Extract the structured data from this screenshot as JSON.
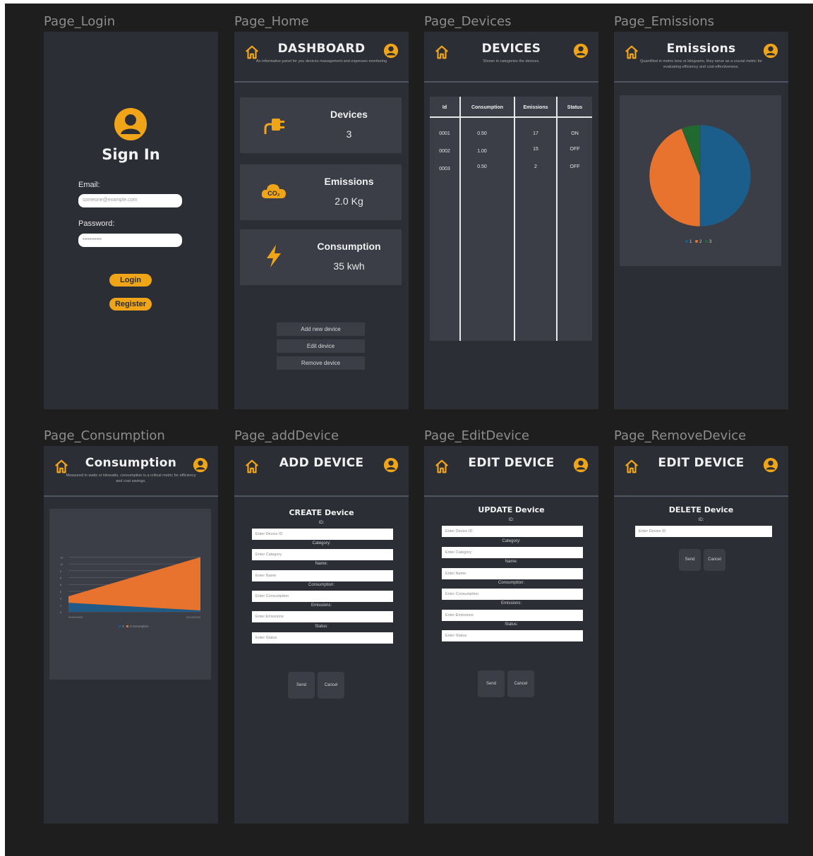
{
  "frames": {
    "login": {
      "label": "Page_Login",
      "title": "Sign In",
      "email_label": "Email:",
      "email_placeholder": "someone@example.com",
      "password_label": "Password:",
      "password_value": "•••••••••••",
      "login_label": "Login",
      "register_label": "Register"
    },
    "home": {
      "label": "Page_Home",
      "title": "DASHBOARD",
      "subtitle": "An informative panel for you devices management and expenses monitoring",
      "cards": [
        {
          "title": "Devices",
          "value": "3",
          "icon": "plug-icon"
        },
        {
          "title": "Emissions",
          "value": "2.0 Kg",
          "icon": "co2-cloud-icon"
        },
        {
          "title": "Consumption",
          "value": "35 kwh",
          "icon": "lightning-icon"
        }
      ],
      "actions": [
        "Add new device",
        "Edit device",
        "Remove device"
      ]
    },
    "devices": {
      "label": "Page_Devices",
      "title": "DEVICES",
      "subtitle": "Shown in categories the devices.",
      "columns": [
        "Id",
        "Consumption",
        "Emissions",
        "Status"
      ],
      "rows": [
        {
          "id": "0001",
          "consumption": "0.50",
          "emissions": "17",
          "status": "ON"
        },
        {
          "id": "0002",
          "consumption": "1.00",
          "emissions": "15",
          "status": "OFF"
        },
        {
          "id": "0003",
          "consumption": "0.50",
          "emissions": "2",
          "status": "OFF"
        }
      ]
    },
    "emissions": {
      "label": "Page_Emissions",
      "title": "Emissions",
      "subtitle": "Quantified in metric tons or kilograms, they serve as a crucial metric for evaluating efficiency and cost-effectiveness.",
      "legend": [
        "1",
        "2",
        "3"
      ]
    },
    "consumption": {
      "label": "Page_Consumption",
      "title": "Consumption",
      "subtitle": "Measured in watts or kilowatts, consumption is a critical metric for efficiency and cost savings.",
      "x_start": "01/01/2023",
      "x_end": "01/12/2023",
      "legend": [
        "X",
        "Consumption"
      ]
    },
    "add": {
      "label": "Page_addDevice",
      "title": "ADD DEVICE",
      "form_title": "CREATE Device",
      "fields": [
        {
          "label": "ID:",
          "placeholder": "Enter Device ID"
        },
        {
          "label": "Category:",
          "placeholder": "Enter Category"
        },
        {
          "label": "Name:",
          "placeholder": "Enter Name"
        },
        {
          "label": "Consumption:",
          "placeholder": "Enter Consumption"
        },
        {
          "label": "Emissions:",
          "placeholder": "Enter Emissions"
        },
        {
          "label": "Status:",
          "placeholder": "Enter Status"
        }
      ],
      "send_label": "Send",
      "cancel_label": "Cancel"
    },
    "edit": {
      "label": "Page_EditDevice",
      "title": "EDIT DEVICE",
      "form_title": "UPDATE Device",
      "fields": [
        {
          "label": "ID:",
          "placeholder": "Enter Device ID"
        },
        {
          "label": "Category:",
          "placeholder": "Enter Category"
        },
        {
          "label": "Name:",
          "placeholder": "Enter Name"
        },
        {
          "label": "Consumption:",
          "placeholder": "Enter Consumption"
        },
        {
          "label": "Emissions:",
          "placeholder": "Enter Emissions"
        },
        {
          "label": "Status:",
          "placeholder": "Enter Status"
        }
      ],
      "send_label": "Send",
      "cancel_label": "Cancel"
    },
    "remove": {
      "label": "Page_RemoveDevice",
      "title": "EDIT DEVICE",
      "form_title": "DELETE Device",
      "fields": [
        {
          "label": "ID:",
          "placeholder": "Enter Device ID"
        }
      ],
      "send_label": "Send",
      "cancel_label": "Cancel"
    }
  },
  "chart_data": [
    {
      "type": "pie",
      "categories": [
        "1",
        "2",
        "3"
      ],
      "values": [
        17,
        15,
        2
      ],
      "colors": [
        "#1b5e8c",
        "#e8732e",
        "#206a2f"
      ]
    },
    {
      "type": "area",
      "x": [
        "01/01/2023",
        "01/12/2023"
      ],
      "series": [
        {
          "name": "X",
          "values": [
            2,
            0.3
          ],
          "color": "#1f5b86"
        },
        {
          "name": "Consumption",
          "values": [
            3.4,
            12
          ],
          "color": "#e8732e"
        }
      ],
      "ylim": [
        0,
        13
      ],
      "grid": true
    }
  ],
  "colors": {
    "accent": "#f0a417",
    "frame_bg": "#2c2e36",
    "card_bg": "#3b3e47",
    "canvas_bg": "#1e1e1e"
  }
}
